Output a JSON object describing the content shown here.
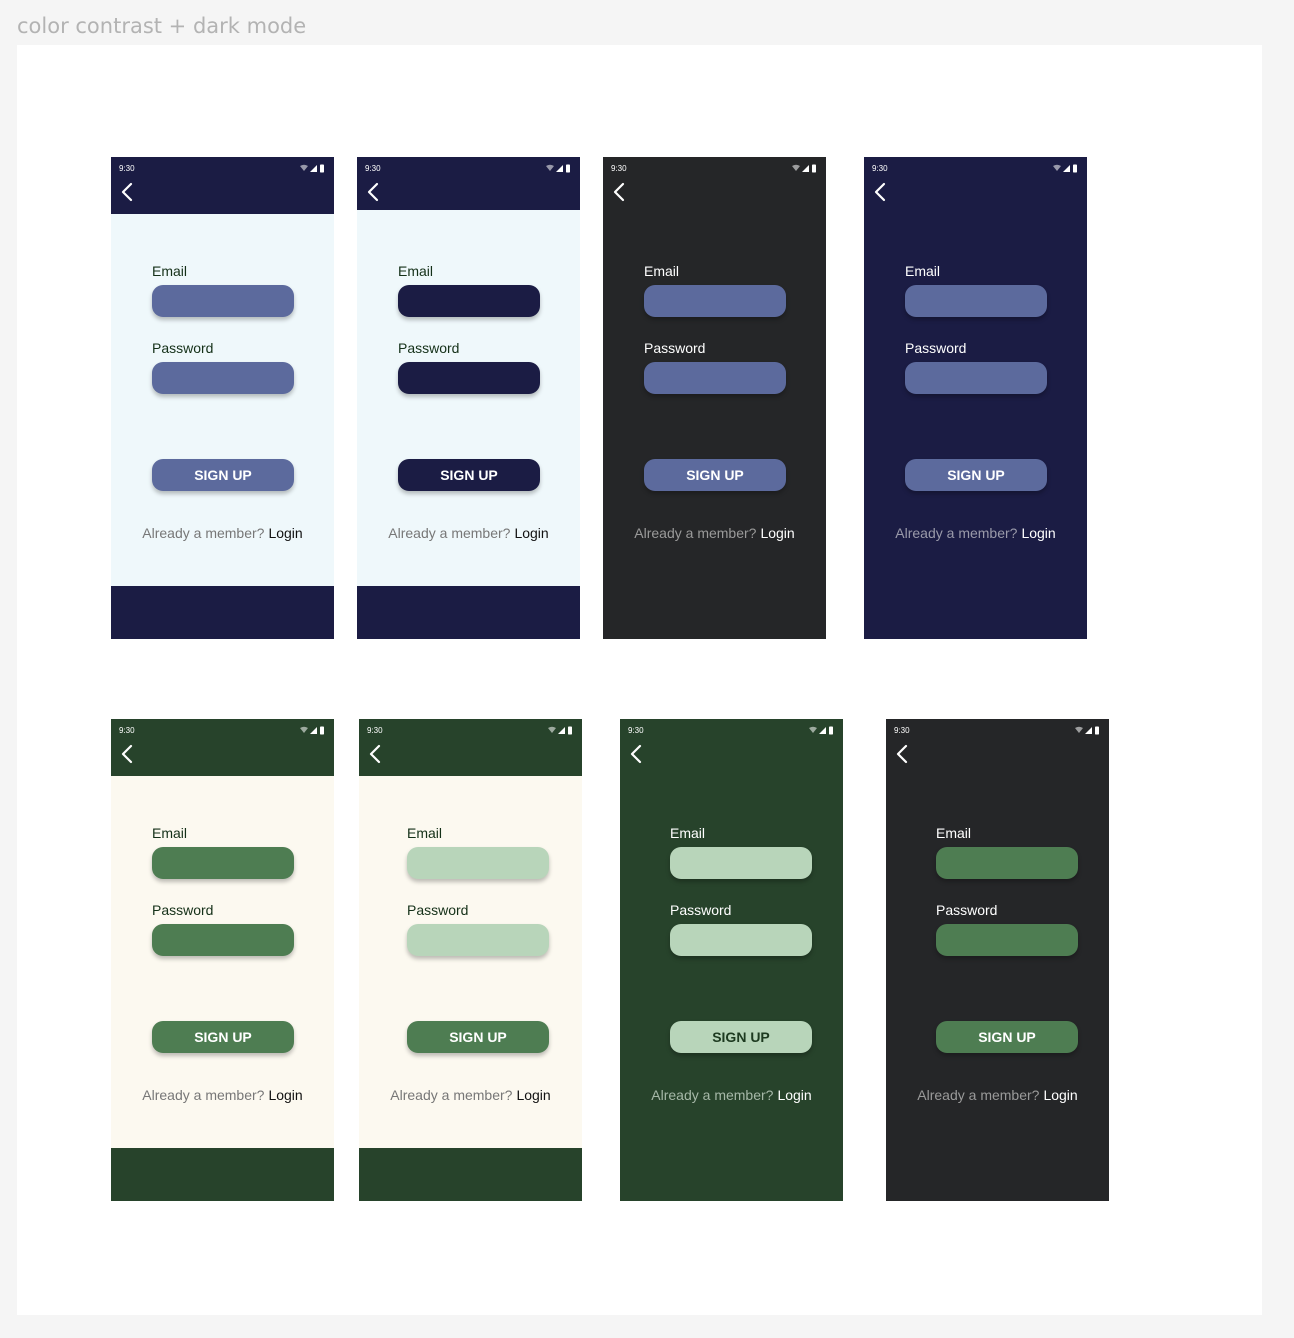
{
  "frame": {
    "label": "color contrast + dark mode"
  },
  "phones": [
    {
      "time": "9:30",
      "email_label": "Email",
      "password_label": "Password",
      "signup_label": "SIGN UP",
      "already_text": "Already a member?",
      "login_text": "Login",
      "colors": {
        "bar": "#1b1c44",
        "body": "#eff8fb",
        "label": "#143018",
        "field": "#5c6a9d",
        "button": "#5c6a9d",
        "button_text": "#ffffff",
        "muted": "#777777",
        "login": "#111111",
        "bottom_bar": "#1b1c44"
      }
    },
    {
      "time": "9:30",
      "email_label": "Email",
      "password_label": "Password",
      "signup_label": "SIGN UP",
      "already_text": "Already a member?",
      "login_text": "Login",
      "colors": {
        "bar": "#1b1c44",
        "body": "#eff8fb",
        "label": "#143018",
        "field": "#1b1c44",
        "button": "#1b1c44",
        "button_text": "#ffffff",
        "muted": "#777777",
        "login": "#111111",
        "bottom_bar": "#1b1c44"
      }
    },
    {
      "time": "9:30",
      "email_label": "Email",
      "password_label": "Password",
      "signup_label": "SIGN UP",
      "already_text": "Already a member?",
      "login_text": "Login",
      "colors": {
        "bar": "#252628",
        "body": "#252628",
        "label": "#ffffff",
        "field": "#5c6a9d",
        "button": "#5c6a9d",
        "button_text": "#ffffff",
        "muted": "#9a9a9a",
        "login": "#ffffff",
        "bottom_bar": "#252628"
      }
    },
    {
      "time": "9:30",
      "email_label": "Email",
      "password_label": "Password",
      "signup_label": "SIGN UP",
      "already_text": "Already a member?",
      "login_text": "Login",
      "colors": {
        "bar": "#1b1c44",
        "body": "#1b1c44",
        "label": "#ffffff",
        "field": "#5c6a9d",
        "button": "#5c6a9d",
        "button_text": "#ffffff",
        "muted": "#9a9aaa",
        "login": "#ffffff",
        "bottom_bar": "#1b1c44"
      }
    },
    {
      "time": "9:30",
      "email_label": "Email",
      "password_label": "Password",
      "signup_label": "SIGN UP",
      "already_text": "Already a member?",
      "login_text": "Login",
      "colors": {
        "bar": "#27432b",
        "body": "#fcf9f0",
        "label": "#143018",
        "field": "#4e7d52",
        "button": "#4e7d52",
        "button_text": "#ffffff",
        "muted": "#777777",
        "login": "#111111",
        "bottom_bar": "#27432b"
      }
    },
    {
      "time": "9:30",
      "email_label": "Email",
      "password_label": "Password",
      "signup_label": "SIGN UP",
      "already_text": "Already a member?",
      "login_text": "Login",
      "colors": {
        "bar": "#27432b",
        "body": "#fcf9f0",
        "label": "#143018",
        "field": "#b8d5ba",
        "button": "#4e7d52",
        "button_text": "#ffffff",
        "muted": "#777777",
        "login": "#111111",
        "bottom_bar": "#27432b"
      }
    },
    {
      "time": "9:30",
      "email_label": "Email",
      "password_label": "Password",
      "signup_label": "SIGN UP",
      "already_text": "Already a member?",
      "login_text": "Login",
      "colors": {
        "bar": "#27432b",
        "body": "#27432b",
        "label": "#ffffff",
        "field": "#b8d5ba",
        "button": "#b8d5ba",
        "button_text": "#1d3a20",
        "muted": "#a6b8a8",
        "login": "#ffffff",
        "bottom_bar": "#27432b"
      }
    },
    {
      "time": "9:30",
      "email_label": "Email",
      "password_label": "Password",
      "signup_label": "SIGN UP",
      "already_text": "Already a member?",
      "login_text": "Login",
      "colors": {
        "bar": "#252628",
        "body": "#252628",
        "label": "#ffffff",
        "field": "#4e7d52",
        "button": "#4e7d52",
        "button_text": "#ffffff",
        "muted": "#9a9a9a",
        "login": "#ffffff",
        "bottom_bar": "#252628"
      }
    }
  ]
}
